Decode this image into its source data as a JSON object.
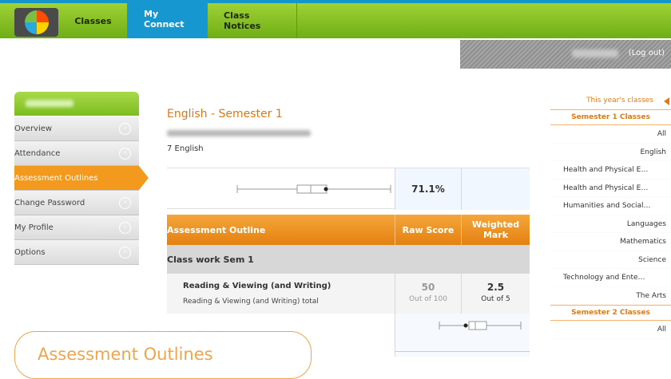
{
  "nav": {
    "items": [
      {
        "label": "Classes",
        "active": false
      },
      {
        "label": "My Connect",
        "active": true
      },
      {
        "label": "Class Notices",
        "active": false
      }
    ]
  },
  "userbar": {
    "logout": "(Log out)"
  },
  "sidebar": {
    "items": [
      {
        "label": "Overview"
      },
      {
        "label": "Attendance"
      },
      {
        "label": "Assessment Outlines",
        "active": true
      },
      {
        "label": "Change Password"
      },
      {
        "label": "My Profile"
      },
      {
        "label": "Options"
      }
    ]
  },
  "main": {
    "title": "English - Semester 1",
    "class_name": "7 English",
    "summary_percent": "71.1%",
    "table": {
      "col_outline": "Assessment Outline",
      "col_raw": "Raw Score",
      "col_weighted": "Weighted Mark",
      "section": "Class work Sem 1",
      "row": {
        "name": "Reading & Viewing (and Writing)",
        "subtitle": "Reading & Viewing (and Writing) total",
        "raw": "50",
        "raw_out_of": "Out of 100",
        "weighted": "2.5",
        "weighted_out_of": "Out of 5"
      }
    }
  },
  "tooltip": {
    "text": "Assessment Outlines"
  },
  "right_panel": {
    "header": "This year's classes",
    "semester1": "Semester 1 Classes",
    "s1_items": [
      "All",
      "English",
      "Health and Physical E…",
      "Health and Physical E…",
      "Humanities and Social…",
      "Languages",
      "Mathematics",
      "Science",
      "Technology and Ente…",
      "The Arts"
    ],
    "semester2": "Semester 2 Classes",
    "s2_items": [
      "All"
    ]
  },
  "colors": {
    "accent_green": "#7bbd1f",
    "accent_blue": "#1697cf",
    "accent_orange": "#f39a1e"
  }
}
